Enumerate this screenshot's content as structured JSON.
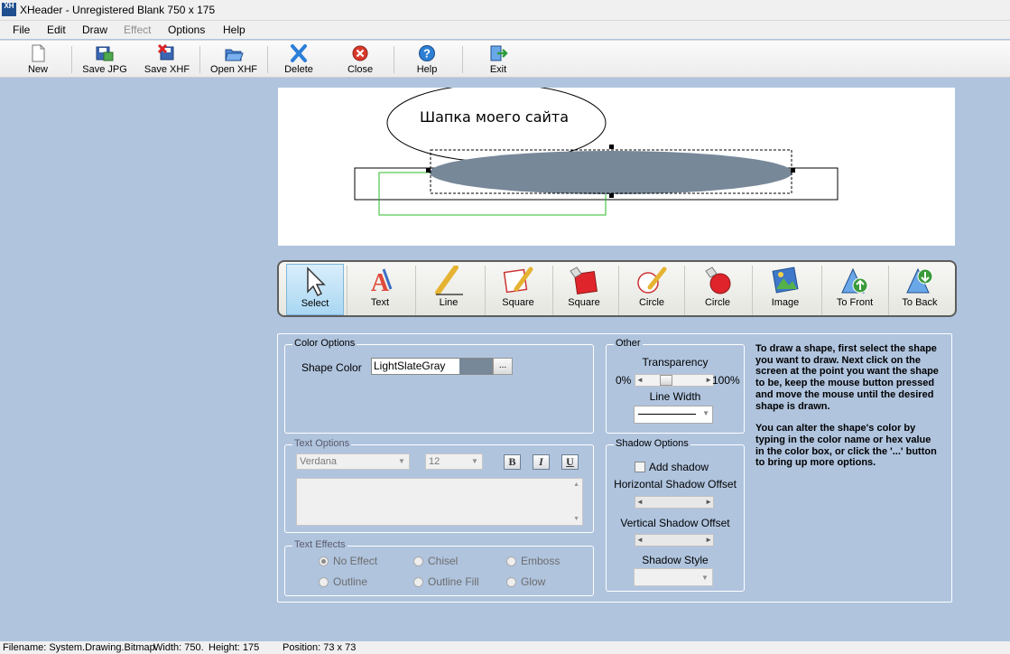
{
  "window": {
    "title": "XHeader - Unregistered Blank 750 x 175",
    "icon_text": "XH"
  },
  "menu": {
    "items": [
      "File",
      "Edit",
      "Draw",
      "Effect",
      "Options",
      "Help"
    ]
  },
  "toolbar": {
    "new": "New",
    "save_jpg": "Save JPG",
    "save_xhf": "Save XHF",
    "open_xhf": "Open XHF",
    "delete": "Delete",
    "close": "Close",
    "help": "Help",
    "exit": "Exit"
  },
  "canvas": {
    "header_text": "Шапка моего сайта",
    "selected_shape_color": "#778899"
  },
  "draw_tools": {
    "select": "Select",
    "text": "Text",
    "line": "Line",
    "square": "Square",
    "square_filled": "Square",
    "circle": "Circle",
    "circle_filled": "Circle",
    "image": "Image",
    "to_front": "To Front",
    "to_back": "To Back",
    "active": "Select"
  },
  "color_options": {
    "title": "Color Options",
    "shape_color_label": "Shape Color",
    "shape_color_value": "LightSlateGray",
    "browse_button": "...",
    "swatch": "#778899"
  },
  "text_options": {
    "title": "Text Options",
    "font": "Verdana",
    "size": "12",
    "bold": "B",
    "italic": "I",
    "underline": "U"
  },
  "text_effects": {
    "title": "Text Effects",
    "no_effect": "No Effect",
    "chisel": "Chisel",
    "emboss": "Emboss",
    "outline": "Outline",
    "outline_fill": "Outline Fill",
    "glow": "Glow",
    "selected": "No Effect"
  },
  "other": {
    "title": "Other",
    "transparency_label": "Transparency",
    "min_label": "0%",
    "max_label": "100%",
    "transparency_value": 0.08,
    "line_width_label": "Line Width"
  },
  "shadow_options": {
    "title": "Shadow Options",
    "add_shadow": "Add shadow",
    "add_shadow_checked": false,
    "h_offset_label": "Horizontal Shadow Offset",
    "v_offset_label": "Vertical Shadow Offset",
    "style_label": "Shadow Style"
  },
  "help": {
    "paragraph1": "To draw a shape, first select the shape you want to draw. Next click on the screen at the point you want the shape to be, keep the mouse button pressed and move the mouse until the desired shape is drawn.",
    "paragraph2": "You can alter the shape's color by typing in the color name or hex value in the color box, or click the '...' button to bring up more options."
  },
  "status": {
    "filename": "Filename: System.Drawing.Bitmap.",
    "width": "Width: 750.",
    "height": "Height: 175",
    "position": "Position: 73 x 73"
  }
}
